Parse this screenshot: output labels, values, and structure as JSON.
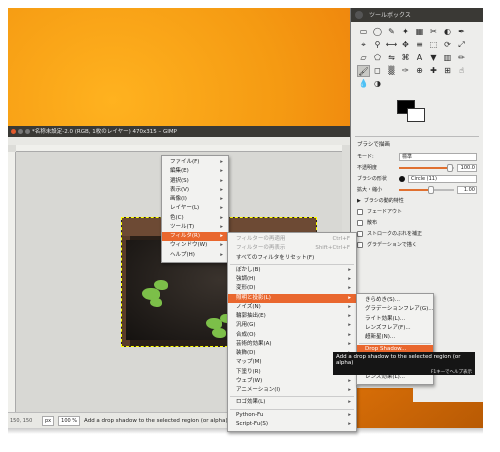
{
  "toolbox": {
    "title": "ツールボックス",
    "tool_icons": [
      "rect-select-icon",
      "ellipse-select-icon",
      "free-select-icon",
      "fuzzy-select-icon",
      "select-by-color-icon",
      "scissors-icon",
      "foreground-select-icon",
      "paths-icon",
      "color-picker-icon",
      "zoom-icon",
      "measure-icon",
      "move-icon",
      "align-icon",
      "crop-icon",
      "rotate-icon",
      "scale-icon",
      "shear-icon",
      "perspective-icon",
      "flip-icon",
      "cage-icon",
      "text-icon",
      "bucket-fill-icon",
      "blend-icon",
      "pencil-icon",
      "paintbrush-icon",
      "eraser-icon",
      "airbrush-icon",
      "ink-icon",
      "clone-icon",
      "heal-icon",
      "perspective-clone-icon",
      "smudge-icon",
      "blur-icon",
      "dodge-burn-icon"
    ],
    "tool_glyphs": [
      "▭",
      "◯",
      "✎",
      "✦",
      "▦",
      "✂",
      "◐",
      "✒",
      "⌖",
      "⚲",
      "⟷",
      "✥",
      "≡",
      "⬚",
      "⟳",
      "⤢",
      "▱",
      "⬠",
      "⇋",
      "⌘",
      "A",
      "▼",
      "▥",
      "✏",
      "🖌",
      "◻",
      "▒",
      "✑",
      "⊕",
      "✚",
      "⊞",
      "☝",
      "💧",
      "◑"
    ],
    "active_tool_index": 24,
    "options_title": "ブラシで描画",
    "mode_label": "モード:",
    "mode_value": "標準",
    "opacity_label": "不透明度",
    "opacity_value": "100.0",
    "brush_label": "ブラシの形状",
    "brush_value": "Circle (11)",
    "size_label": "拡大・縮小",
    "size_value": "1.00",
    "dynamics_label": "ブラシの動的特性",
    "fade_label": "フェードアウト",
    "jitter_label": "散布",
    "smooth_label": "ストロークのぶれを補正",
    "gradient_label": "グラデーションで描く"
  },
  "image_window": {
    "title": "*名称未設定-2.0 (RGB, 1枚のレイヤー) 470x315 – GIMP",
    "status_coords": "150, 150",
    "unit": "px",
    "zoom": "100 %",
    "status_message": "Add a drop shadow to the selected region (or alpha)"
  },
  "menu_main": {
    "items": [
      {
        "label": "ファイル(F)",
        "sub": true
      },
      {
        "label": "編集(E)",
        "sub": true
      },
      {
        "label": "選択(S)",
        "sub": true
      },
      {
        "label": "表示(V)",
        "sub": true
      },
      {
        "label": "画像(I)",
        "sub": true
      },
      {
        "label": "レイヤー(L)",
        "sub": true
      },
      {
        "label": "色(C)",
        "sub": true
      },
      {
        "label": "ツール(T)",
        "sub": true
      },
      {
        "label": "フィルタ(R)",
        "sub": true,
        "highlighted": true
      },
      {
        "label": "ウィンドウ(W)",
        "sub": true
      },
      {
        "label": "ヘルプ(H)",
        "sub": true
      }
    ]
  },
  "menu_filters": {
    "repeat_last": "フィルターの再適用",
    "repeat_last_shortcut": "Ctrl+F",
    "reshow_last": "フィルターの再表示",
    "reshow_last_shortcut": "Shift+Ctrl+F",
    "reset_all": "すべてのフィルタをリセット(F)",
    "groups": [
      [
        "ぼかし(B)",
        "強調(H)",
        "変形(D)",
        "照明と投影(L)",
        "ノイズ(N)",
        "輪郭抽出(E)",
        "汎用(G)",
        "合成(O)",
        "芸術的効果(A)",
        "装飾(D)",
        "マップ(M)",
        "下塗り(R)",
        "ウェブ(W)",
        "アニメーション(I)"
      ],
      [
        "ロゴ効果(L)"
      ],
      [
        "Python-Fu",
        "Script-Fu(S)"
      ]
    ],
    "highlighted": "照明と投影(L)"
  },
  "menu_light": {
    "items": [
      "きらめき(S)...",
      "グラデーションフレア(G)...",
      "ライト効果(L)...",
      "レンズフレア(F)...",
      "超新星(N)...",
      "Drop Shadow...",
      "パースペクティブ(P)...",
      "ガラスタイル(G)...",
      "レンズ効果(L)..."
    ],
    "highlighted": "Drop Shadow..."
  },
  "tooltip": {
    "text": "Add a drop shadow to the selected region (or alpha)",
    "hint": "F1キーでヘルプ表示"
  },
  "colors": {
    "accent": "#e9672e",
    "titlebar": "#3a3935",
    "desktop": "#f59a12"
  }
}
